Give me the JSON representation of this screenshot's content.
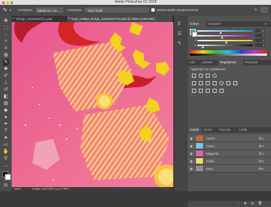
{
  "window": {
    "title": "Adobe Photoshop CC 2018"
  },
  "options_bar": {
    "sample_label": "Campione:",
    "sample_value": "Media 11 x 11",
    "layer_sample_label": "Campione:",
    "layer_sample_value": "Tutti i livelli",
    "sampling_ring_label": "Mostra anello campionamento"
  },
  "document_tabs": [
    {
      "label": "ECrgb_converted f1A.psd"
    },
    {
      "label": "food_1446pt_ECrgb_converted F13.psd @ 100% (CMYK/8*)"
    }
  ],
  "status": {
    "zoom": "100%",
    "doc_info": "Profilo: FACTORI CL2-TYPE1"
  },
  "color_panel": {
    "tabs": [
      "Colore",
      "Campioni"
    ],
    "values": [
      {
        "label": "C",
        "value": "42",
        "fraction": 0.42,
        "color": "#00a5d8"
      },
      {
        "label": "M",
        "value": "0",
        "fraction": 0.45,
        "color": "#d8008a"
      },
      {
        "label": "Y",
        "value": "0",
        "fraction": 0.52,
        "color": "#e5d300"
      },
      {
        "label": "K",
        "value": "0",
        "fraction": 0.1,
        "color": "#000000"
      }
    ]
  },
  "adjust_panel": {
    "tabs": [
      "Info",
      "Librerie",
      "Regolazioni",
      "Proprietà"
    ],
    "heading": "Aggiungi una regolazione"
  },
  "channels_panel": {
    "tabs": [
      "Canali",
      "Storia",
      "Tracciati",
      "Livelli"
    ],
    "channels": [
      {
        "name": "CMYK",
        "shortcut": "⌘2",
        "thumb_color": "#c2683e"
      },
      {
        "name": "Ciano",
        "shortcut": "⌘3",
        "thumb_color": "#78c8e8"
      },
      {
        "name": "Magenta",
        "shortcut": "⌘4",
        "thumb_color": "#e860b0"
      },
      {
        "name": "Giallo",
        "shortcut": "⌘5",
        "thumb_color": "#e8e070"
      },
      {
        "name": "Nero",
        "shortcut": "⌘6",
        "thumb_color": "#909090"
      }
    ]
  }
}
